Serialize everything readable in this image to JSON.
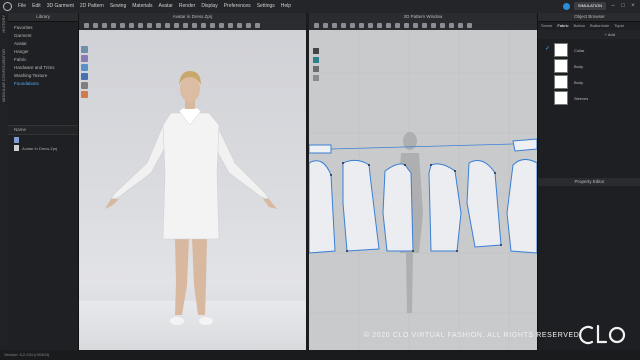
{
  "menu": [
    "File",
    "Edit",
    "3D Garment",
    "2D Pattern",
    "Sewing",
    "Materials",
    "Avatar",
    "Render",
    "Display",
    "Preferences",
    "Settings",
    "Help"
  ],
  "top_right": {
    "simulation_label": "SIMULATION"
  },
  "left_tabs": [
    "HISTORY",
    "MODULAR CONFIGURATOR"
  ],
  "library": {
    "title": "Library",
    "items": [
      "Favorites",
      "Garment",
      "Avatar",
      "Hanger",
      "Fabric",
      "Hardware and Trims",
      "Washing Texture",
      "Foundations"
    ],
    "selected_index": 7,
    "files_header": "Name",
    "files": [
      "Avatar in Dress.Zprj"
    ]
  },
  "view3d": {
    "title": "Avatar in Dress.Zprj"
  },
  "view2d": {
    "title": "2D Pattern Window"
  },
  "object_browser": {
    "title": "Object Browser",
    "tabs": [
      "Scene",
      "Fabric",
      "Button",
      "Buttonhole",
      "Topst"
    ],
    "active_tab": 1,
    "add_label": "Add",
    "fabrics": [
      "Collar",
      "Body",
      "Body",
      "Sleeves"
    ]
  },
  "property_editor": {
    "title": "Property Editor"
  },
  "status": {
    "version": "Version: 5.2.234 (r40304)"
  },
  "overlay": {
    "copyright": "© 2020 CLO VIRTUAL FASHION. ALL RIGHTS RESERVED.",
    "logo": "CLO"
  },
  "colors": {
    "accent": "#52aef0",
    "pattern_outline": "#3a7fd6"
  }
}
